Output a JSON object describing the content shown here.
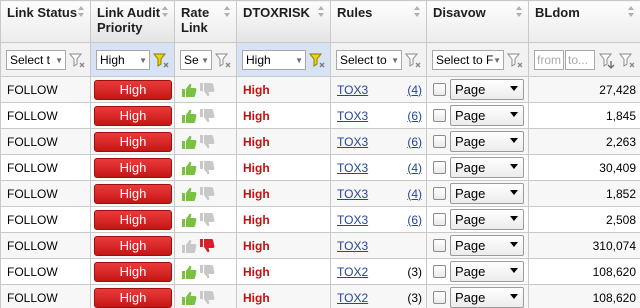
{
  "headers": {
    "link_status": "Link Status",
    "audit_priority_1": "Link Audit",
    "audit_priority_2": "Priority",
    "rate_1": "Rate",
    "rate_2": "Link",
    "dtoxrisk": "DTOXRISK",
    "rules": "Rules",
    "disavow": "Disavow",
    "bldom": "BLdom"
  },
  "filters": {
    "link_status": "Select t",
    "audit_priority": "High",
    "rate": "Se",
    "dtoxrisk": "High",
    "rules": "Select to",
    "disavow": "Select to F",
    "bldom_from": "from",
    "bldom_to": "to..."
  },
  "rows": [
    {
      "status": "FOLLOW",
      "priority": "High",
      "rating": "up",
      "risk": "High",
      "rule": "TOX3",
      "count": "(4)",
      "count_link": true,
      "disavow": "Page",
      "bldom": "27,428"
    },
    {
      "status": "FOLLOW",
      "priority": "High",
      "rating": "up",
      "risk": "High",
      "rule": "TOX3",
      "count": "(6)",
      "count_link": true,
      "disavow": "Page",
      "bldom": "1,845"
    },
    {
      "status": "FOLLOW",
      "priority": "High",
      "rating": "up",
      "risk": "High",
      "rule": "TOX3",
      "count": "(6)",
      "count_link": true,
      "disavow": "Page",
      "bldom": "2,263"
    },
    {
      "status": "FOLLOW",
      "priority": "High",
      "rating": "up",
      "risk": "High",
      "rule": "TOX3",
      "count": "(4)",
      "count_link": true,
      "disavow": "Page",
      "bldom": "30,409"
    },
    {
      "status": "FOLLOW",
      "priority": "High",
      "rating": "up",
      "risk": "High",
      "rule": "TOX3",
      "count": "(4)",
      "count_link": true,
      "disavow": "Page",
      "bldom": "1,852"
    },
    {
      "status": "FOLLOW",
      "priority": "High",
      "rating": "up",
      "risk": "High",
      "rule": "TOX3",
      "count": "(6)",
      "count_link": true,
      "disavow": "Page",
      "bldom": "2,508"
    },
    {
      "status": "FOLLOW",
      "priority": "High",
      "rating": "down",
      "risk": "High",
      "rule": "TOX3",
      "count": "",
      "count_link": false,
      "disavow": "Page",
      "bldom": "310,074"
    },
    {
      "status": "FOLLOW",
      "priority": "High",
      "rating": "up",
      "risk": "High",
      "rule": "TOX2",
      "count": "(3)",
      "count_link": false,
      "disavow": "Page",
      "bldom": "108,620"
    },
    {
      "status": "FOLLOW",
      "priority": "High",
      "rating": "up",
      "risk": "High",
      "rule": "TOX2",
      "count": "(3)",
      "count_link": false,
      "disavow": "Page",
      "bldom": "108,620"
    }
  ],
  "colors": {
    "priority_badge": "#d92525",
    "risk_text": "#c31010",
    "link": "#24459a",
    "thumb_up": "#7ac142",
    "thumb_down_active": "#d61f2c",
    "thumb_inactive": "#c8c8c8",
    "filter_active": "#f0d400"
  },
  "icons": {
    "filter": "funnel-filter-icon",
    "sort": "sort-arrows-icon",
    "thumb_up": "thumbs-up-icon",
    "thumb_down": "thumbs-down-icon"
  }
}
